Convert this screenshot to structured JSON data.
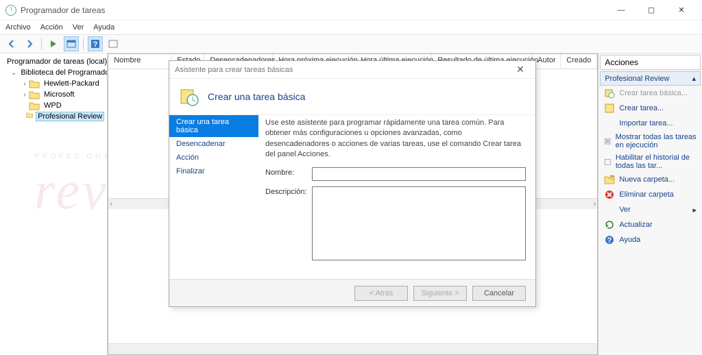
{
  "window": {
    "title": "Programador de tareas",
    "buttons": {
      "min": "—",
      "max": "▢",
      "close": "✕"
    }
  },
  "menu": {
    "items": [
      "Archivo",
      "Acción",
      "Ver",
      "Ayuda"
    ]
  },
  "tree": {
    "root": "Programador de tareas (local)",
    "lib": "Biblioteca del Programador de tareas",
    "items": [
      "Hewlett-Packard",
      "Microsoft",
      "WPD",
      "Profesional Review"
    ]
  },
  "columns": [
    "Nombre",
    "Estado",
    "Desencadenadores",
    "Hora próxima ejecución",
    "Hora última ejecución",
    "Resultado de última ejecución",
    "Autor",
    "Creado"
  ],
  "actions": {
    "header": "Acciones",
    "section": "Profesional Review",
    "items": [
      {
        "label": "Crear tarea básica...",
        "disabled": true
      },
      {
        "label": "Crear tarea..."
      },
      {
        "label": "Importar tarea..."
      },
      {
        "label": "Mostrar todas las tareas en ejecución"
      },
      {
        "label": "Habilitar el historial de todas las tar..."
      },
      {
        "label": "Nueva carpeta..."
      },
      {
        "label": "Eliminar carpeta"
      },
      {
        "label": "Ver",
        "submenu": true
      },
      {
        "label": "Actualizar"
      },
      {
        "label": "Ayuda"
      }
    ]
  },
  "wizard": {
    "windowTitle": "Asistente para crear tareas básicas",
    "heading": "Crear una tarea básica",
    "steps": [
      "Crear una tarea básica",
      "Desencadenar",
      "Acción",
      "Finalizar"
    ],
    "description": "Use este asistente para programar rápidamente una tarea común. Para obtener más configuraciones u opciones avanzadas, como desencadenadores o acciones de varias tareas, use el comando Crear tarea del panel Acciones.",
    "fields": {
      "name_label": "Nombre:",
      "desc_label": "Descripción:",
      "name_value": "",
      "desc_value": ""
    },
    "buttons": {
      "back": "< Atrás",
      "next": "Siguiente >",
      "cancel": "Cancelar"
    }
  },
  "watermark": {
    "line1": "PROFES   ONAL",
    "line2": "review"
  }
}
